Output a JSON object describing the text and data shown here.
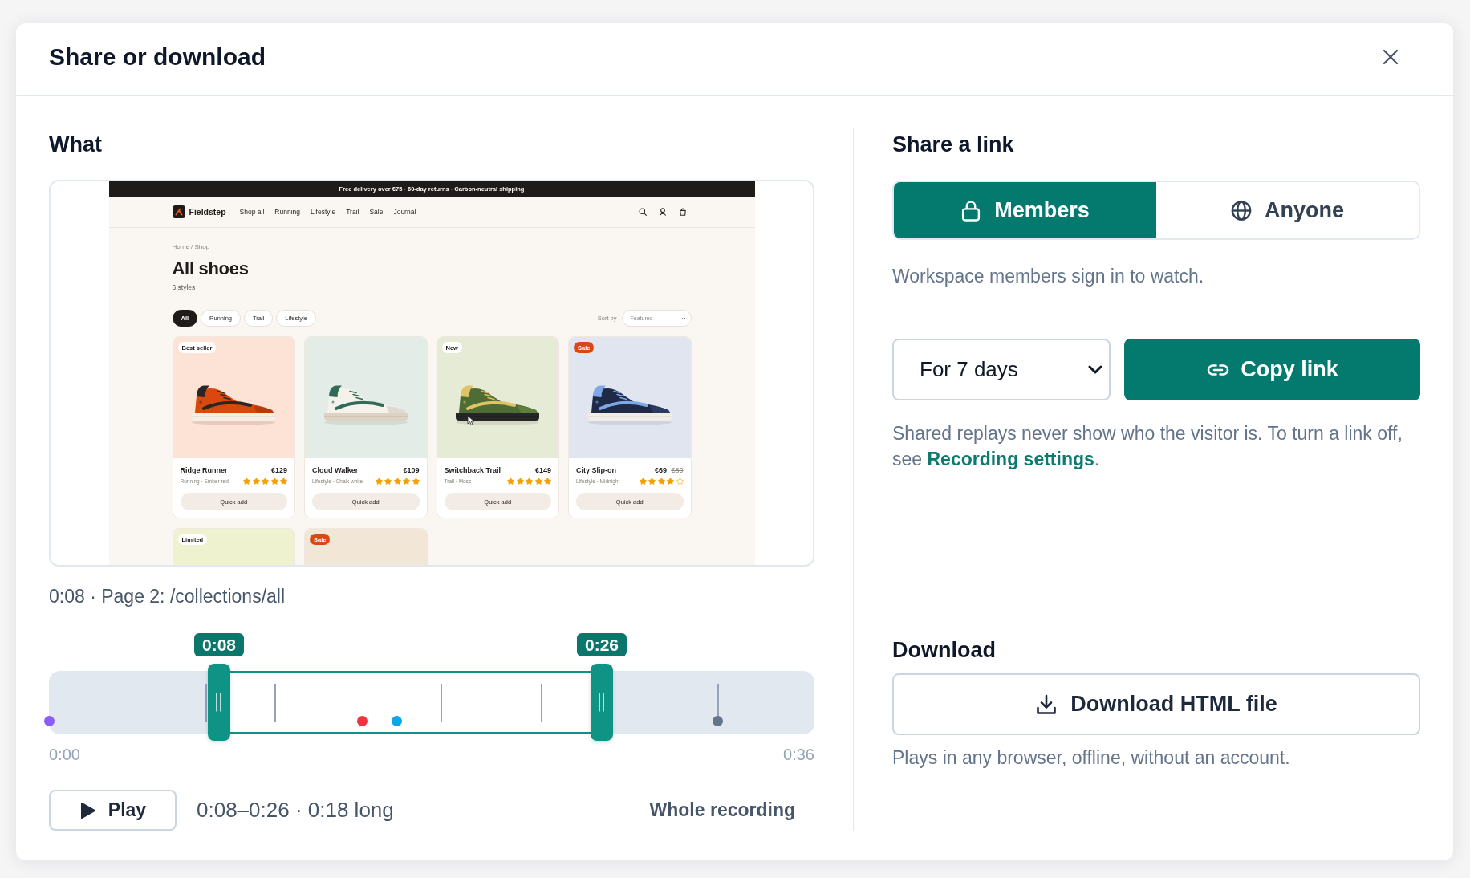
{
  "dialog": {
    "title": "Share or download"
  },
  "what": {
    "heading": "What",
    "preview": {
      "announcement": "Free delivery over €75 · 60-day returns · Carbon-neutral shipping",
      "brand": "Fieldstep",
      "nav_links": [
        "Shop all",
        "Running",
        "Lifestyle",
        "Trail",
        "Sale",
        "Journal"
      ],
      "breadcrumb": "Home / Shop",
      "title": "All shoes",
      "count": "6 styles",
      "filters": [
        {
          "label": "All",
          "selected": true
        },
        {
          "label": "Running",
          "selected": false
        },
        {
          "label": "Trail",
          "selected": false
        },
        {
          "label": "Lifestyle",
          "selected": false
        }
      ],
      "sort_label": "Sort by",
      "sort_value": "Featured",
      "products": [
        {
          "badge": {
            "text": "Best seller",
            "kind": "label"
          },
          "name": "Ridge Runner",
          "price": "€129",
          "details": "Running · Ember red",
          "stars": 5,
          "button": "Quick add"
        },
        {
          "name": "Cloud Walker",
          "price": "€109",
          "details": "Lifestyle · Chalk white",
          "stars": 5,
          "button": "Quick add"
        },
        {
          "badge": {
            "text": "New",
            "kind": "label"
          },
          "name": "Switchback Trail",
          "price": "€149",
          "details": "Trail · Moss",
          "stars": 5,
          "button": "Quick add"
        },
        {
          "badge": {
            "text": "Sale",
            "kind": "sale"
          },
          "name": "City Slip-on",
          "price": "€69",
          "old_price": "€89",
          "details": "Lifestyle · Midnight",
          "stars": 4,
          "button": "Quick add"
        },
        {
          "badge": {
            "text": "Limited",
            "kind": "label"
          }
        },
        {
          "badge": {
            "text": "Sale",
            "kind": "sale"
          }
        }
      ]
    },
    "caption": "0:08 · Page 2: /collections/all",
    "timeline": {
      "start": {
        "label": "0:08",
        "level": 0.2222
      },
      "end": {
        "label": "0:26",
        "level": 0.7222
      },
      "page_marks": [
        {
          "level": 0.205
        },
        {
          "level": 0.296
        },
        {
          "level": 0.513
        },
        {
          "level": 0.644
        },
        {
          "level": 0.874
        }
      ],
      "events": [
        {
          "level": 0,
          "color": "#8b5cf6"
        },
        {
          "level": 0.409,
          "color": "#ef3340"
        },
        {
          "level": 0.454,
          "color": "#0ea5e9"
        },
        {
          "level": 0.874,
          "color": "#64748b"
        }
      ],
      "min_label": "0:00",
      "max_label": "0:36"
    },
    "play_button": "Play",
    "range_summary": "0:08–0:26 · 0:18 long",
    "whole_recording_button": "Whole recording"
  },
  "share": {
    "heading": "Share a link",
    "access_options": [
      {
        "label": "Members",
        "kind": "members",
        "selected": true
      },
      {
        "label": "Anyone",
        "kind": "public",
        "selected": false
      }
    ],
    "access_description": "Workspace members sign in to watch.",
    "duration": {
      "value": "For 7 days"
    },
    "copy_button": "Copy link",
    "note": {
      "before": "Shared replays never show who the visitor is. To turn a link off, see ",
      "link": "Recording settings",
      "after": "."
    }
  },
  "download": {
    "heading": "Download",
    "button": "Download HTML file",
    "description": "Plays in any browser, offline, without an account."
  }
}
